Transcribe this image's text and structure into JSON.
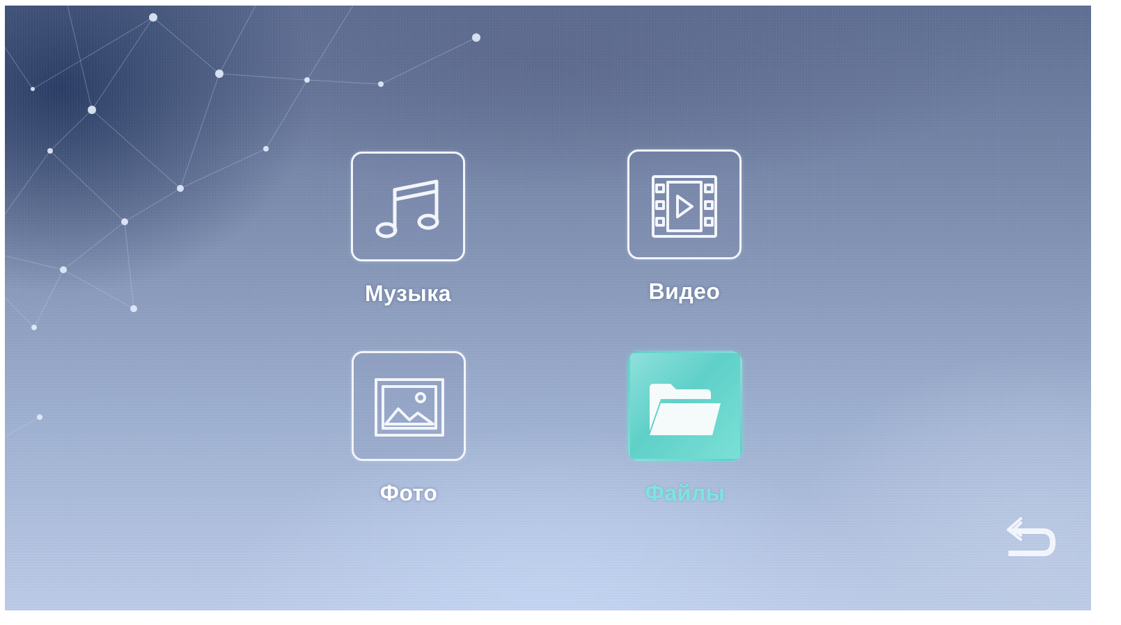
{
  "menu": {
    "items": [
      {
        "id": "music",
        "label": "Музыка",
        "icon": "music-note-icon",
        "selected": false
      },
      {
        "id": "video",
        "label": "Видео",
        "icon": "film-icon",
        "selected": false
      },
      {
        "id": "photo",
        "label": "Фото",
        "icon": "picture-icon",
        "selected": false
      },
      {
        "id": "files",
        "label": "Файлы",
        "icon": "folder-icon",
        "selected": true
      }
    ]
  },
  "navigation": {
    "back_icon": "back-arrow-icon"
  },
  "colors": {
    "icon_outline": "#f2f5fb",
    "selected_tile": "#5fd0c8",
    "selected_label": "#7fe3e0",
    "label": "#ffffff"
  }
}
